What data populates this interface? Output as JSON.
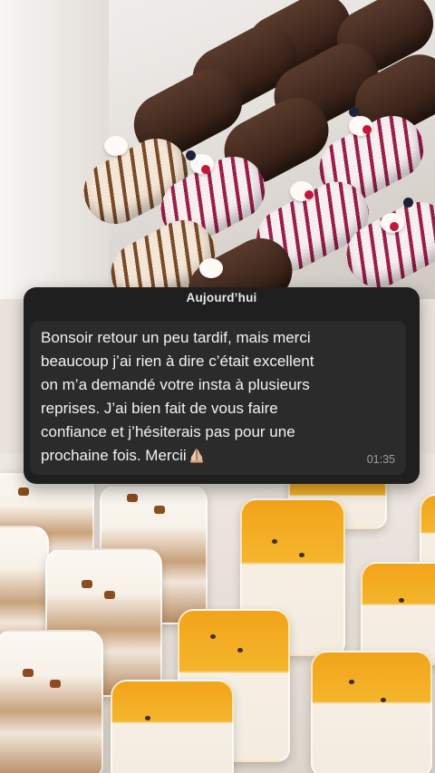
{
  "chat": {
    "date_label": "Aujourd’hui",
    "message": {
      "text": "Bonsoir retour un peu tardif, mais merci\nbeaucoup j’ai rien à dire c’était excellent\non m’a demandé votre insta à plusieurs\nreprises. J’ai bien fait de vous faire\nconfiance et j’hésiterais pas pour une\nprochaine fois. Mercii",
      "emoji_icon": "praying-hands-icon",
      "time": "01:35"
    }
  },
  "colors": {
    "overlay_bg": "#1f1f1f",
    "bubble_bg": "#2b2b2b",
    "text": "#f2f2f2",
    "time": "#9c9c9c"
  }
}
